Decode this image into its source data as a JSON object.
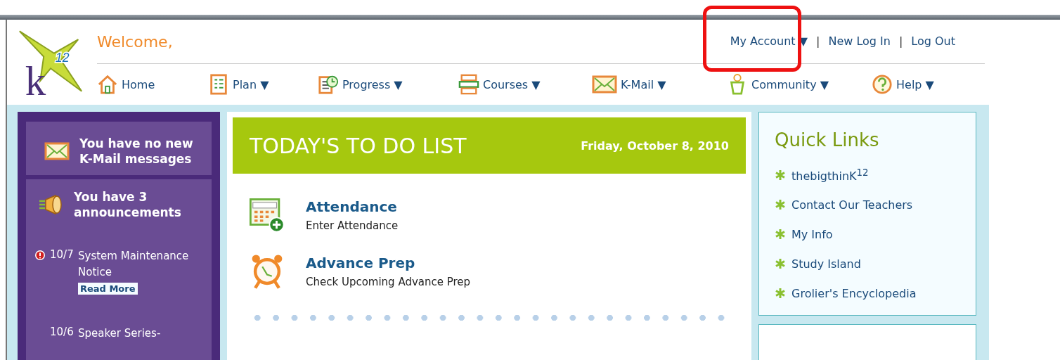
{
  "header": {
    "logo": {
      "letter": "k",
      "superscript": "12"
    },
    "welcome": "Welcome,",
    "account_links": [
      {
        "label": "My Account ▼"
      },
      {
        "label": "New Log In"
      },
      {
        "label": "Log Out"
      }
    ],
    "separators": [
      "|",
      "|"
    ],
    "nav": [
      {
        "kind": "home",
        "label": "Home"
      },
      {
        "kind": "plan",
        "label": "Plan ▼"
      },
      {
        "kind": "progress",
        "label": "Progress ▼"
      },
      {
        "kind": "courses",
        "label": "Courses ▼"
      },
      {
        "kind": "mail",
        "label": "K-Mail ▼"
      },
      {
        "kind": "community",
        "label": "Community ▼"
      },
      {
        "kind": "help",
        "label": "Help ▼"
      }
    ]
  },
  "sidebar": {
    "mail_message": "You have no new K-Mail messages",
    "announcements_title": "You have 3 announcements",
    "announcements": [
      {
        "important": true,
        "date": "10/7",
        "title": "System Maintenance Notice",
        "read_more": "Read More"
      },
      {
        "important": false,
        "date": "10/6",
        "title": "Speaker Series-"
      }
    ]
  },
  "todo": {
    "title": "TODAY'S TO DO LIST",
    "date": "Friday, October 8, 2010",
    "items": [
      {
        "kind": "attendance",
        "title": "Attendance",
        "subtitle": "Enter Attendance"
      },
      {
        "kind": "alarm",
        "title": "Advance Prep",
        "subtitle": "Check Upcoming Advance Prep"
      }
    ]
  },
  "quick_links": {
    "title": "Quick Links",
    "links": [
      "thebigthinK$^{12}$",
      "Contact Our Teachers",
      "My Info",
      "Study Island",
      "Grolier's Encyclopedia"
    ]
  }
}
